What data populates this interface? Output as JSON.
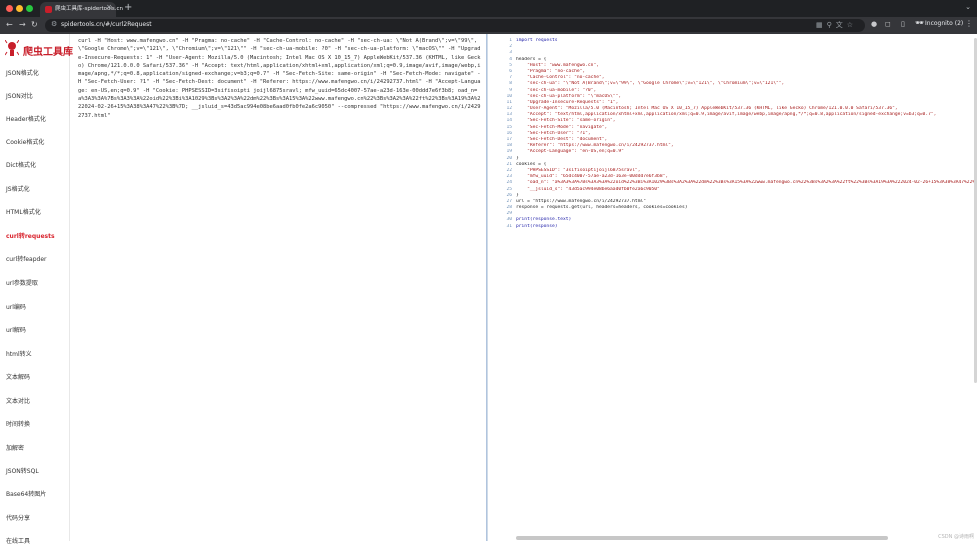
{
  "browser": {
    "tab_title": "爬虫工具库-spidertools.cn",
    "url": "spidertools.cn/#/curl2Request",
    "incognito_label": "Incognito (2)",
    "icons": [
      "back-icon",
      "forward-icon",
      "reload-icon",
      "site-info-icon",
      "qr-icon",
      "search-icon",
      "translate-icon",
      "star-icon",
      "extension-icon",
      "sidebar-icon",
      "incognito-icon",
      "menu-icon"
    ]
  },
  "app": {
    "logo_text": "爬虫工具库",
    "brand_color": "#c81e2a",
    "nav": [
      {
        "label": "JSON格式化"
      },
      {
        "label": "JSON对比"
      },
      {
        "label": "Header格式化"
      },
      {
        "label": "Cookie格式化"
      },
      {
        "label": "Dict格式化"
      },
      {
        "label": "JS格式化"
      },
      {
        "label": "HTML格式化"
      },
      {
        "label": "curl转requests",
        "active": true
      },
      {
        "label": "curl转feapder"
      },
      {
        "label": "url参数提取"
      },
      {
        "label": "url编码"
      },
      {
        "label": "url解码"
      },
      {
        "label": "html转义"
      },
      {
        "label": "文本解码"
      },
      {
        "label": "文本对比"
      },
      {
        "label": "时间转换"
      },
      {
        "label": "加解密"
      },
      {
        "label": "JSON转SQL"
      },
      {
        "label": "Base64转图片"
      },
      {
        "label": "代码分享"
      },
      {
        "label": "在线工具"
      }
    ]
  },
  "input": {
    "curl": "curl -H \"Host: www.mafengwo.cn\" -H \"Pragma: no-cache\" -H \"Cache-Control: no-cache\" -H \"sec-ch-ua: \\\"Not A(Brand\\\";v=\\\"99\\\", \\\"Google Chrome\\\";v=\\\"121\\\", \\\"Chromium\\\";v=\\\"121\\\"\" -H \"sec-ch-ua-mobile: ?0\" -H \"sec-ch-ua-platform: \\\"macOS\\\"\" -H \"Upgrade-Insecure-Requests: 1\" -H \"User-Agent: Mozilla/5.0 (Macintosh; Intel Mac OS X 10_15_7) AppleWebKit/537.36 (KHTML, like Gecko) Chrome/121.0.0.0 Safari/537.36\" -H \"Accept: text/html,application/xhtml+xml,application/xml;q=0.9,image/avif,image/webp,image/apng,*/*;q=0.8,application/signed-exchange;v=b3;q=0.7\" -H \"Sec-Fetch-Site: same-origin\" -H \"Sec-Fetch-Mode: navigate\" -H \"Sec-Fetch-User: ?1\" -H \"Sec-Fetch-Dest: document\" -H \"Referer: https://www.mafengwo.cn/i/24292737.html\" -H \"Accept-Language: en-US,en;q=0.9\" -H \"Cookie: PHPSESSID=3sifisoipti joijl6875sravl; mfw_uuid=65dc4007-57ae-a23d-163e-00ddd7e6f3b8; oad_n=a%3A3%3A%7Bs%3A3%3A%22oid%22%3Bi%3A1029%3Bs%3A2%3A%22dm%22%3Bs%3A15%3A%22www.mafengwo.cn%22%3Bs%3A2%3A%22ft%22%3Bs%3A19%3A%222024-02-26+15%3A38%3A47%22%3B%7D; __jsluid_s=43d5ac994e08be6aad0fb0fe2a6c9050\" --compressed \"https://www.mafengwo.cn/i/24292737.html\""
  },
  "output": {
    "lines": [
      {
        "n": "1",
        "text": "import requests",
        "kind": "kw"
      },
      {
        "n": "2",
        "text": "",
        "kind": ""
      },
      {
        "n": "3",
        "text": "",
        "kind": ""
      },
      {
        "n": "4",
        "text": "headers = {",
        "kind": ""
      },
      {
        "n": "5",
        "text": "    \"Host\": \"www.mafengwo.cn\",",
        "kind": "str"
      },
      {
        "n": "6",
        "text": "    \"Pragma\": \"no-cache\",",
        "kind": "str"
      },
      {
        "n": "7",
        "text": "    \"Cache-Control\": \"no-cache\",",
        "kind": "str"
      },
      {
        "n": "8",
        "text": "    \"sec-ch-ua\": \"\\\"Not A(Brand\\\";v=\\\"99\\\", \\\"Google Chrome\\\";v=\\\"121\\\", \\\"Chromium\\\";v=\\\"121\\\"\",",
        "kind": "str"
      },
      {
        "n": "9",
        "text": "    \"sec-ch-ua-mobile\": \"?0\",",
        "kind": "str"
      },
      {
        "n": "10",
        "text": "    \"sec-ch-ua-platform\": \"\\\"macOS\\\"\",",
        "kind": "str"
      },
      {
        "n": "11",
        "text": "    \"Upgrade-Insecure-Requests\": \"1\",",
        "kind": "str"
      },
      {
        "n": "12",
        "text": "    \"User-Agent\": \"Mozilla/5.0 (Macintosh; Intel Mac OS X 10_15_7) AppleWebKit/537.36 (KHTML, like Gecko) Chrome/121.0.0.0 Safari/537.36\",",
        "kind": "str"
      },
      {
        "n": "13",
        "text": "    \"Accept\": \"text/html,application/xhtml+xml,application/xml;q=0.9,image/avif,image/webp,image/apng,*/*;q=0.8,application/signed-exchange;v=b3;q=0.7\",",
        "kind": "str"
      },
      {
        "n": "14",
        "text": "    \"Sec-Fetch-Site\": \"same-origin\",",
        "kind": "str"
      },
      {
        "n": "15",
        "text": "    \"Sec-Fetch-Mode\": \"navigate\",",
        "kind": "str"
      },
      {
        "n": "16",
        "text": "    \"Sec-Fetch-User\": \"?1\",",
        "kind": "str"
      },
      {
        "n": "17",
        "text": "    \"Sec-Fetch-Dest\": \"document\",",
        "kind": "str"
      },
      {
        "n": "18",
        "text": "    \"Referer\": \"https://www.mafengwo.cn/i/24292737.html\",",
        "kind": "str"
      },
      {
        "n": "19",
        "text": "    \"Accept-Language\": \"en-US,en;q=0.9\"",
        "kind": "str"
      },
      {
        "n": "20",
        "text": "}",
        "kind": ""
      },
      {
        "n": "21",
        "text": "cookies = {",
        "kind": ""
      },
      {
        "n": "22",
        "text": "    \"PHPSESSID\": \"3sifisoiptijoijl6875sravl\",",
        "kind": "str"
      },
      {
        "n": "23",
        "text": "    \"mfw_uuid\": \"65dc4007-57ae-a23d-163e-00ddd7e6f3b8\",",
        "kind": "str"
      },
      {
        "n": "24",
        "text": "    \"oad_n\": \"a%3A3%3A%7Bs%3A3%3A%22oid%22%3Bi%3A1029%3Bs%3A2%3A%22dm%22%3Bs%3A15%3A%22www.mafengwo.cn%22%3Bs%3A2%3A%22ft%22%3Bs%3A19%3A%222024-02-26+15%3A38%3A47%22%3B%7D\",",
        "kind": "str"
      },
      {
        "n": "25",
        "text": "    \"__jsluid_s\": \"43d5ac994e08be6aad0fb0fe2a6c9050\"",
        "kind": "str"
      },
      {
        "n": "26",
        "text": "}",
        "kind": ""
      },
      {
        "n": "27",
        "text": "url = \"https://www.mafengwo.cn/i/24292737.html\"",
        "kind": ""
      },
      {
        "n": "28",
        "text": "response = requests.get(url, headers=headers, cookies=cookies)",
        "kind": ""
      },
      {
        "n": "29",
        "text": "",
        "kind": ""
      },
      {
        "n": "30",
        "text": "print(response.text)",
        "kind": "fn"
      },
      {
        "n": "31",
        "text": "print(response)",
        "kind": "fn"
      }
    ]
  },
  "watermark": "CSDN @诗雨啊"
}
